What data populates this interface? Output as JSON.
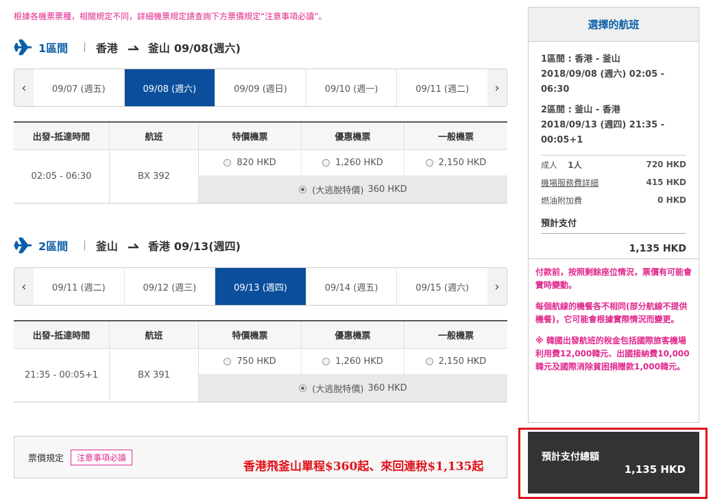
{
  "notice": "根據各機票票種，相關規定不同，詳細機票規定請查詢下方票價規定“注意事項必讀”。",
  "sections": [
    {
      "label": "1區間",
      "from": "香港",
      "to": "釜山",
      "date": "09/08(週六)",
      "dates": [
        "09/07 (週五)",
        "09/08 (週六)",
        "09/09 (週日)",
        "09/10 (週一)",
        "09/11 (週二)"
      ],
      "active_index": 1,
      "headers": [
        "出發-抵達時間",
        "航班",
        "特價機票",
        "優惠機票",
        "一般機票"
      ],
      "time": "02:05 - 06:30",
      "flight": "BX 392",
      "fare_special": "820 HKD",
      "fare_discount": "1,260 HKD",
      "fare_normal": "2,150 HKD",
      "promo_name": "(大逃脫特價)",
      "promo_price": "360 HKD"
    },
    {
      "label": "2區間",
      "from": "釜山",
      "to": "香港",
      "date": "09/13(週四)",
      "dates": [
        "09/11 (週二)",
        "09/12 (週三)",
        "09/13 (週四)",
        "09/14 (週五)",
        "09/15 (週六)"
      ],
      "active_index": 2,
      "headers": [
        "出發-抵達時間",
        "航班",
        "特價機票",
        "優惠機票",
        "一般機票"
      ],
      "time": "21:35 - 00:05+1",
      "flight": "BX 391",
      "fare_special": "750 HKD",
      "fare_discount": "1,260 HKD",
      "fare_normal": "2,150 HKD",
      "promo_name": "(大逃脫特價)",
      "promo_price": "360 HKD"
    }
  ],
  "rules": {
    "label": "票價規定",
    "button": "注意事項必讀",
    "promo_text": "香港飛釜山單程$360起、來回連稅$1,135起"
  },
  "sidebar": {
    "title": "選擇的航班",
    "leg1_title": "1區間 : 香港 - 釜山",
    "leg1_time": "2018/09/08 (週六) 02:05 - 06:30",
    "leg2_title": "2區間 : 釜山 - 香港",
    "leg2_time": "2018/09/13 (週四) 21:35 -",
    "leg2_time2": "00:05+1",
    "adult_label": "成人",
    "adult_count": "1人",
    "adult_amount": "720 HKD",
    "airport_fee_label": "機場服務費詳細",
    "airport_fee_amount": "415 HKD",
    "fuel_label": "燃油附加費",
    "fuel_amount": "0 HKD",
    "estimate_label": "預計支付",
    "estimate_value": "1,135 HKD",
    "note1": "付款前，按照剩餘座位情況，票價有可能會實時變動。",
    "note2": "每個航線的機餐各不相同(部分航線不提供機餐)，它可能會根據實際情況而變更。",
    "note3": "※ 韓國出發航班的稅金包括國際旅客機場利用費12,000韓元、出國接納費10,000韓元及國際消除貧困捐贈款1,000韓元。"
  },
  "total": {
    "label": "預計支付總額",
    "value": "1,135 HKD"
  },
  "colors": {
    "accent_blue": "#0b4f9c",
    "notice_pink": "#e0278c",
    "promo_red": "#e0121a"
  },
  "icons": {
    "plane": "plane-icon",
    "route_arrow": "route-arrow-icon",
    "prev": "chevron-left-icon",
    "next": "chevron-right-icon",
    "radio": "radio-icon"
  }
}
